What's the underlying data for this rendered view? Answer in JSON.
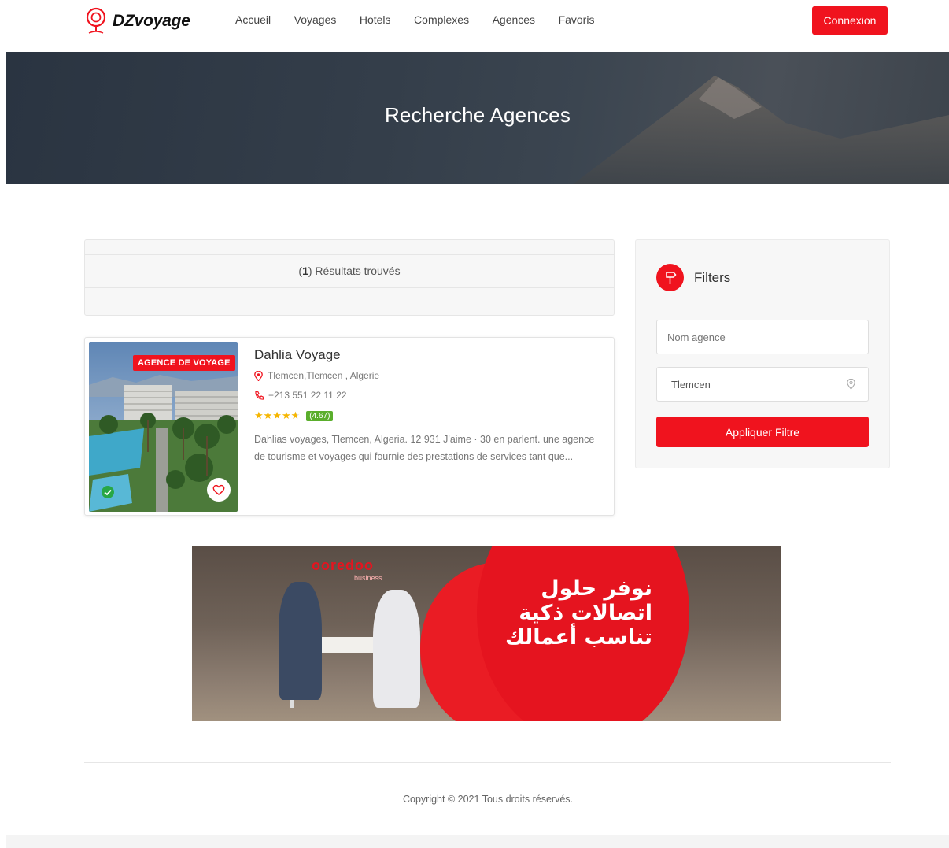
{
  "brand": {
    "name": "DZvoyage",
    "accent": "#f0131e"
  },
  "nav": {
    "items": [
      {
        "label": "Accueil"
      },
      {
        "label": "Voyages"
      },
      {
        "label": "Hotels"
      },
      {
        "label": "Complexes"
      },
      {
        "label": "Agences"
      },
      {
        "label": "Favoris"
      }
    ],
    "login_label": "Connexion"
  },
  "hero": {
    "title": "Recherche Agences"
  },
  "results": {
    "count": "1",
    "label": "Résultats trouvés"
  },
  "agency": {
    "badge": "AGENCE DE VOYAGE",
    "name": "Dahlia Voyage",
    "address": "Tlemcen,Tlemcen , Algerie",
    "phone": "+213 551 22 11 22",
    "rating": 4.67,
    "rating_label": "(4.67)",
    "description": "Dahlias voyages, Tlemcen, Algeria. 12 931 J'aime · 30 en parlent. une agence de tourisme et voyages qui fournie des prestations de services tant que...",
    "verified_icon": "check-circle-icon",
    "favorite_icon": "heart-icon"
  },
  "filters": {
    "title": "Filters",
    "name_placeholder": "Nom agence",
    "city_value": "Tlemcen",
    "apply_label": "Appliquer Filtre",
    "icon": "signpost-icon"
  },
  "banner": {
    "brand": "ooredoo",
    "sub": "business",
    "text_line1": "نوفر حلول",
    "text_line2": "اتصالات ذكية",
    "text_line3": "تناسب أعمالك"
  },
  "footer": {
    "copyright": "Copyright © 2021 Tous droits réservés."
  }
}
